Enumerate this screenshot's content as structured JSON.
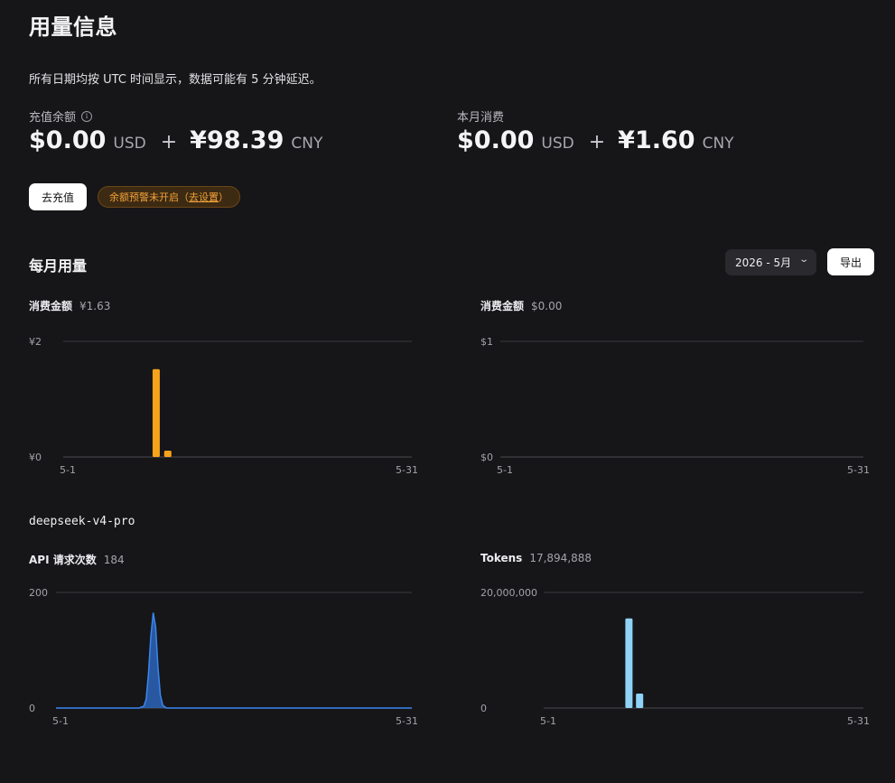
{
  "page": {
    "title": "用量信息",
    "note": "所有日期均按 UTC 时间显示，数据可能有 5 分钟延迟。"
  },
  "balance": {
    "label": "充值余额",
    "info_icon": "info-icon",
    "usd": "$0.00",
    "usd_unit": "USD",
    "plus": "+",
    "cny": "¥98.39",
    "cny_unit": "CNY"
  },
  "monthly_spend": {
    "label": "本月消费",
    "usd": "$0.00",
    "usd_unit": "USD",
    "plus": "+",
    "cny": "¥1.60",
    "cny_unit": "CNY"
  },
  "actions": {
    "topup_label": "去充值",
    "warning_text": "余额预警未开启（",
    "warning_link": "去设置",
    "warning_close": "）"
  },
  "usage": {
    "section_title": "每月用量",
    "month_select": "2026 - 5月",
    "export_label": "导出",
    "model_name": "deepseek-v4-pro"
  },
  "colors": {
    "orange": "#f7a21b",
    "blue": "#2f6fcf",
    "light_blue": "#8fd3f7",
    "warning": "#f2a33a"
  },
  "chart_data": [
    {
      "type": "bar",
      "label": "消费金额",
      "summary": "¥1.63",
      "ylim": [
        0,
        2
      ],
      "yticks": [
        "¥0",
        "¥2"
      ],
      "ytick_values": [
        0,
        2
      ],
      "xlim": [
        1,
        31
      ],
      "xticks": [
        "5-1",
        "5-31"
      ],
      "color": "#f7a21b",
      "points": [
        {
          "x": 9,
          "y": 1.52
        },
        {
          "x": 10,
          "y": 0.11
        }
      ]
    },
    {
      "type": "bar",
      "label": "消费金额",
      "summary": "$0.00",
      "ylim": [
        0,
        1
      ],
      "yticks": [
        "$0",
        "$1"
      ],
      "ytick_values": [
        0,
        1
      ],
      "xlim": [
        1,
        31
      ],
      "xticks": [
        "5-1",
        "5-31"
      ],
      "color": "#f7a21b",
      "points": []
    },
    {
      "type": "area",
      "label": "API 请求次数",
      "summary": "184",
      "ylim": [
        0,
        200
      ],
      "yticks": [
        "0",
        "200"
      ],
      "ytick_values": [
        0,
        200
      ],
      "xlim": [
        1,
        31
      ],
      "xticks": [
        "5-1",
        "5-31"
      ],
      "color": "#2f6fcf",
      "points": [
        {
          "x": 1,
          "y": 0
        },
        {
          "x": 8,
          "y": 0
        },
        {
          "x": 8.4,
          "y": 3
        },
        {
          "x": 8.6,
          "y": 15
        },
        {
          "x": 8.8,
          "y": 60
        },
        {
          "x": 9,
          "y": 125
        },
        {
          "x": 9.2,
          "y": 165
        },
        {
          "x": 9.4,
          "y": 140
        },
        {
          "x": 9.6,
          "y": 70
        },
        {
          "x": 9.8,
          "y": 22
        },
        {
          "x": 10,
          "y": 5
        },
        {
          "x": 10.3,
          "y": 0
        },
        {
          "x": 31,
          "y": 0
        }
      ]
    },
    {
      "type": "bar",
      "label": "Tokens",
      "summary": "17,894,888",
      "ylim": [
        0,
        20000000
      ],
      "yticks": [
        "0",
        "20,000,000"
      ],
      "ytick_values": [
        0,
        20000000
      ],
      "xlim": [
        1,
        31
      ],
      "xticks": [
        "5-1",
        "5-31"
      ],
      "color": "#8fd3f7",
      "points": [
        {
          "x": 9,
          "y": 15500000
        },
        {
          "x": 10,
          "y": 2500000
        }
      ]
    }
  ]
}
